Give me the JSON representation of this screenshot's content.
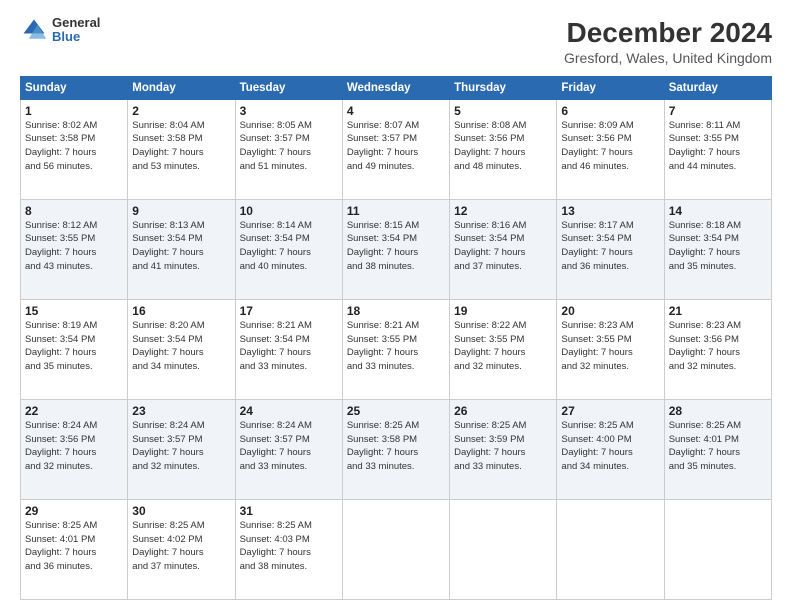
{
  "logo": {
    "general": "General",
    "blue": "Blue"
  },
  "title": "December 2024",
  "subtitle": "Gresford, Wales, United Kingdom",
  "headers": [
    "Sunday",
    "Monday",
    "Tuesday",
    "Wednesday",
    "Thursday",
    "Friday",
    "Saturday"
  ],
  "weeks": [
    [
      {
        "day": "1",
        "sunrise": "8:02 AM",
        "sunset": "3:58 PM",
        "daylight": "7 hours and 56 minutes."
      },
      {
        "day": "2",
        "sunrise": "8:04 AM",
        "sunset": "3:58 PM",
        "daylight": "7 hours and 53 minutes."
      },
      {
        "day": "3",
        "sunrise": "8:05 AM",
        "sunset": "3:57 PM",
        "daylight": "7 hours and 51 minutes."
      },
      {
        "day": "4",
        "sunrise": "8:07 AM",
        "sunset": "3:57 PM",
        "daylight": "7 hours and 49 minutes."
      },
      {
        "day": "5",
        "sunrise": "8:08 AM",
        "sunset": "3:56 PM",
        "daylight": "7 hours and 48 minutes."
      },
      {
        "day": "6",
        "sunrise": "8:09 AM",
        "sunset": "3:56 PM",
        "daylight": "7 hours and 46 minutes."
      },
      {
        "day": "7",
        "sunrise": "8:11 AM",
        "sunset": "3:55 PM",
        "daylight": "7 hours and 44 minutes."
      }
    ],
    [
      {
        "day": "8",
        "sunrise": "8:12 AM",
        "sunset": "3:55 PM",
        "daylight": "7 hours and 43 minutes."
      },
      {
        "day": "9",
        "sunrise": "8:13 AM",
        "sunset": "3:54 PM",
        "daylight": "7 hours and 41 minutes."
      },
      {
        "day": "10",
        "sunrise": "8:14 AM",
        "sunset": "3:54 PM",
        "daylight": "7 hours and 40 minutes."
      },
      {
        "day": "11",
        "sunrise": "8:15 AM",
        "sunset": "3:54 PM",
        "daylight": "7 hours and 38 minutes."
      },
      {
        "day": "12",
        "sunrise": "8:16 AM",
        "sunset": "3:54 PM",
        "daylight": "7 hours and 37 minutes."
      },
      {
        "day": "13",
        "sunrise": "8:17 AM",
        "sunset": "3:54 PM",
        "daylight": "7 hours and 36 minutes."
      },
      {
        "day": "14",
        "sunrise": "8:18 AM",
        "sunset": "3:54 PM",
        "daylight": "7 hours and 35 minutes."
      }
    ],
    [
      {
        "day": "15",
        "sunrise": "8:19 AM",
        "sunset": "3:54 PM",
        "daylight": "7 hours and 35 minutes."
      },
      {
        "day": "16",
        "sunrise": "8:20 AM",
        "sunset": "3:54 PM",
        "daylight": "7 hours and 34 minutes."
      },
      {
        "day": "17",
        "sunrise": "8:21 AM",
        "sunset": "3:54 PM",
        "daylight": "7 hours and 33 minutes."
      },
      {
        "day": "18",
        "sunrise": "8:21 AM",
        "sunset": "3:55 PM",
        "daylight": "7 hours and 33 minutes."
      },
      {
        "day": "19",
        "sunrise": "8:22 AM",
        "sunset": "3:55 PM",
        "daylight": "7 hours and 32 minutes."
      },
      {
        "day": "20",
        "sunrise": "8:23 AM",
        "sunset": "3:55 PM",
        "daylight": "7 hours and 32 minutes."
      },
      {
        "day": "21",
        "sunrise": "8:23 AM",
        "sunset": "3:56 PM",
        "daylight": "7 hours and 32 minutes."
      }
    ],
    [
      {
        "day": "22",
        "sunrise": "8:24 AM",
        "sunset": "3:56 PM",
        "daylight": "7 hours and 32 minutes."
      },
      {
        "day": "23",
        "sunrise": "8:24 AM",
        "sunset": "3:57 PM",
        "daylight": "7 hours and 32 minutes."
      },
      {
        "day": "24",
        "sunrise": "8:24 AM",
        "sunset": "3:57 PM",
        "daylight": "7 hours and 33 minutes."
      },
      {
        "day": "25",
        "sunrise": "8:25 AM",
        "sunset": "3:58 PM",
        "daylight": "7 hours and 33 minutes."
      },
      {
        "day": "26",
        "sunrise": "8:25 AM",
        "sunset": "3:59 PM",
        "daylight": "7 hours and 33 minutes."
      },
      {
        "day": "27",
        "sunrise": "8:25 AM",
        "sunset": "4:00 PM",
        "daylight": "7 hours and 34 minutes."
      },
      {
        "day": "28",
        "sunrise": "8:25 AM",
        "sunset": "4:01 PM",
        "daylight": "7 hours and 35 minutes."
      }
    ],
    [
      {
        "day": "29",
        "sunrise": "8:25 AM",
        "sunset": "4:01 PM",
        "daylight": "7 hours and 36 minutes."
      },
      {
        "day": "30",
        "sunrise": "8:25 AM",
        "sunset": "4:02 PM",
        "daylight": "7 hours and 37 minutes."
      },
      {
        "day": "31",
        "sunrise": "8:25 AM",
        "sunset": "4:03 PM",
        "daylight": "7 hours and 38 minutes."
      },
      null,
      null,
      null,
      null
    ]
  ],
  "labels": {
    "sunrise": "Sunrise:",
    "sunset": "Sunset:",
    "daylight": "Daylight hours"
  }
}
